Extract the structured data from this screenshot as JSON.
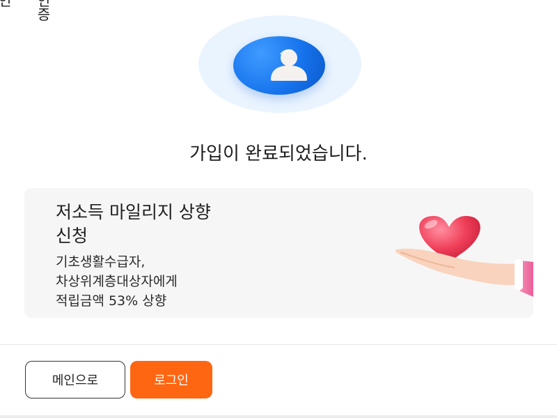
{
  "header": {
    "corner_text_1": "인",
    "corner_text_2a": "인",
    "corner_text_2b": "증"
  },
  "signup": {
    "avatar_icon": "user-icon",
    "message": "가입이 완료되었습니다."
  },
  "promo": {
    "title_line1": "저소득 마일리지 상향",
    "title_line2": "신청",
    "description": "기초생활수급자,\n차상위계층대상자에게\n적립금액 53% 상향",
    "illustration": "heart-in-hand-icon"
  },
  "actions": {
    "main_label": "메인으로",
    "login_label": "로그인"
  },
  "colors": {
    "accent": "#ff6611",
    "avatar_blue": "#1673ec",
    "heart": "#f0405a"
  }
}
